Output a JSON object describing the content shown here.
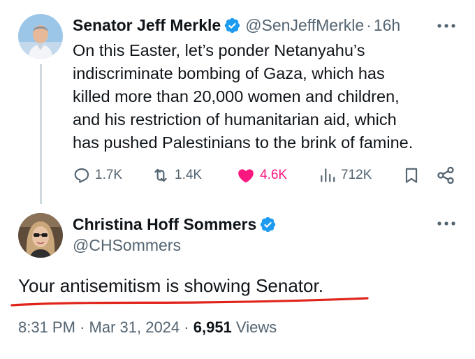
{
  "parent_tweet": {
    "author_name": "Senator Jeff Merkle",
    "handle": "@SenJeffMerkle",
    "separator": "·",
    "time": "16h",
    "lines": [
      "On this Easter, let’s ponder Netanyahu’s",
      "indiscriminate bombing of Gaza, which has",
      "killed more than 20,000 women and children,",
      "and his restriction of humanitarian aid, which",
      "has pushed Palestinians to the brink of famine."
    ],
    "actions": {
      "replies": "1.7K",
      "reposts": "1.4K",
      "likes": "4.6K",
      "views": "712K"
    }
  },
  "reply_tweet": {
    "author_name": "Christina Hoff Sommers",
    "handle": "@CHSommers",
    "text": "Your antisemitism is showing Senator.",
    "time": "8:31 PM",
    "separator": "·",
    "date": "Mar 31, 2024",
    "separator2": "·",
    "views_count": "6,951",
    "views_label": "Views"
  },
  "colors": {
    "verified_blue": "#1d9bf0",
    "like_pink": "#f91880",
    "secondary_text": "#536471",
    "underline_red": "#e0241b"
  },
  "icons": [
    "verified-badge-icon",
    "more-icon",
    "reply-icon",
    "repost-icon",
    "heart-icon",
    "views-icon",
    "bookmark-icon",
    "share-icon"
  ]
}
